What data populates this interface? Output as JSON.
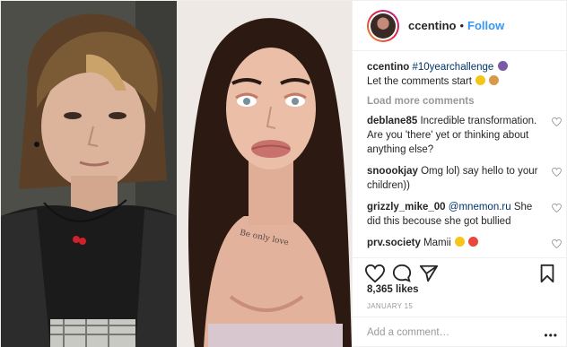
{
  "post": {
    "username": "ccentino",
    "follow_label": "Follow",
    "caption_user": "ccentino",
    "caption_hashtag": "#10yearchallenge",
    "caption_text": "Let the comments start",
    "load_more": "Load more comments",
    "comments": [
      {
        "user": "deblane85",
        "text": "Incredible transformation. Are you 'there' yet or thinking about anything else?"
      },
      {
        "user": "snoookjay",
        "text": "Omg lol) say hello to your children))"
      },
      {
        "user": "grizzly_mike_00",
        "mention": "@mnemon.ru",
        "text": "She did this becouse she got bullied"
      },
      {
        "user": "prv.society",
        "text": "Mamii"
      }
    ],
    "likes": "8,365 likes",
    "date": "JANUARY 15",
    "add_comment_placeholder": "Add a comment…",
    "more_options": "•••"
  },
  "colors": {
    "link_blue": "#3897f0",
    "mention_blue": "#003569",
    "muted_gray": "#999999",
    "text": "#262626"
  },
  "icons": [
    "heart-icon",
    "comment-icon",
    "share-icon",
    "bookmark-icon",
    "more-options-icon"
  ]
}
